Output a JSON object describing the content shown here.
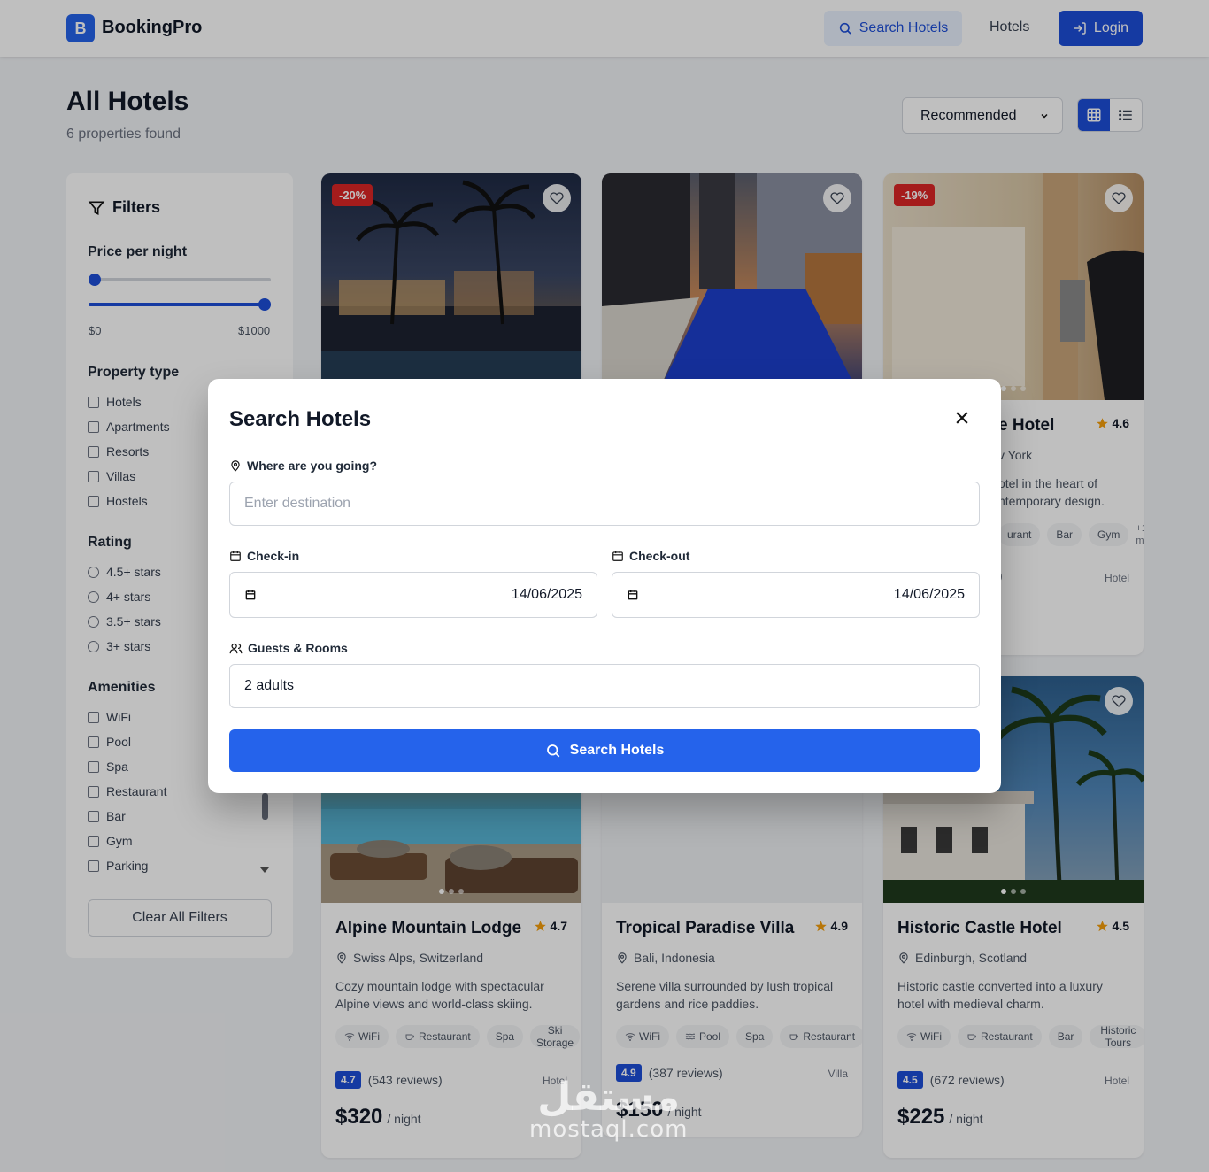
{
  "header": {
    "logo_letter": "B",
    "brand": "BookingPro",
    "nav_search": "Search Hotels",
    "nav_hotels": "Hotels",
    "nav_login": "Login"
  },
  "title": "All Hotels",
  "subtitle": "6 properties found",
  "sort": {
    "selected": "Recommended"
  },
  "sidebar": {
    "title": "Filters",
    "price": {
      "title": "Price per night",
      "min_label": "$0",
      "max_label": "$1000"
    },
    "property_type": {
      "title": "Property type",
      "options": [
        "Hotels",
        "Apartments",
        "Resorts",
        "Villas",
        "Hostels"
      ]
    },
    "rating": {
      "title": "Rating",
      "options": [
        "4.5+ stars",
        "4+ stars",
        "3.5+ stars",
        "3+ stars"
      ]
    },
    "amenities": {
      "title": "Amenities",
      "options": [
        "WiFi",
        "Pool",
        "Spa",
        "Restaurant",
        "Bar",
        "Gym",
        "Parking"
      ]
    },
    "clear": "Clear All Filters"
  },
  "cards": [
    {
      "discount": "-20%"
    },
    {},
    {
      "discount": "-19%",
      "name_partial": "e Hotel",
      "rating": "4.6",
      "loc_partial": "v York",
      "desc_partial": "otel in the heart of ntemporary design.",
      "tags": [
        "urant",
        "Bar",
        "Gym"
      ],
      "more": "+1 mor",
      "type": "Hotel",
      "score_partial": ")"
    },
    {
      "name": "Alpine Mountain Lodge",
      "rating": "4.7",
      "location": "Swiss Alps, Switzerland",
      "desc": "Cozy mountain lodge with spectacular Alpine views and world-class skiing.",
      "tags": [
        "WiFi",
        "Restaurant",
        "Spa",
        "Ski Storage"
      ],
      "score": "4.7",
      "reviews": "(543 reviews)",
      "type": "Hotel",
      "price": "$320",
      "per": "/ night"
    },
    {
      "name": "Tropical Paradise Villa",
      "rating": "4.9",
      "location": "Bali, Indonesia",
      "desc": "Serene villa surrounded by lush tropical gardens and rice paddies.",
      "tags": [
        "WiFi",
        "Pool",
        "Spa",
        "Restaurant"
      ],
      "score": "4.9",
      "reviews": "(387 reviews)",
      "type": "Villa",
      "price": "$150",
      "per": "/ night"
    },
    {
      "name": "Historic Castle Hotel",
      "rating": "4.5",
      "location": "Edinburgh, Scotland",
      "desc": "Historic castle converted into a luxury hotel with medieval charm.",
      "tags": [
        "WiFi",
        "Restaurant",
        "Bar",
        "Historic Tours"
      ],
      "score": "4.5",
      "reviews": "(672 reviews)",
      "type": "Hotel",
      "price": "$225",
      "per": "/ night"
    }
  ],
  "modal": {
    "title": "Search Hotels",
    "destination_label": "Where are you going?",
    "destination_placeholder": "Enter destination",
    "checkin_label": "Check-in",
    "checkin_value": "14/06/2025",
    "checkout_label": "Check-out",
    "checkout_value": "14/06/2025",
    "guests_label": "Guests & Rooms",
    "guests_value": "2 adults",
    "button": "Search Hotels"
  },
  "watermark": {
    "line1": "مستقل",
    "line2": "mostaql.com"
  },
  "colors": {
    "primary": "#2563eb",
    "primary_dark": "#1d4ed8",
    "discount": "#dc2626",
    "star": "#f59e0b"
  },
  "icons": {
    "search": "search-icon",
    "login": "login-icon",
    "filter": "filter-icon",
    "heart": "heart-icon",
    "star": "star-icon",
    "pin": "map-pin-icon",
    "calendar": "calendar-icon",
    "users": "users-icon",
    "close": "close-icon",
    "grid": "grid-icon",
    "list": "list-icon"
  }
}
